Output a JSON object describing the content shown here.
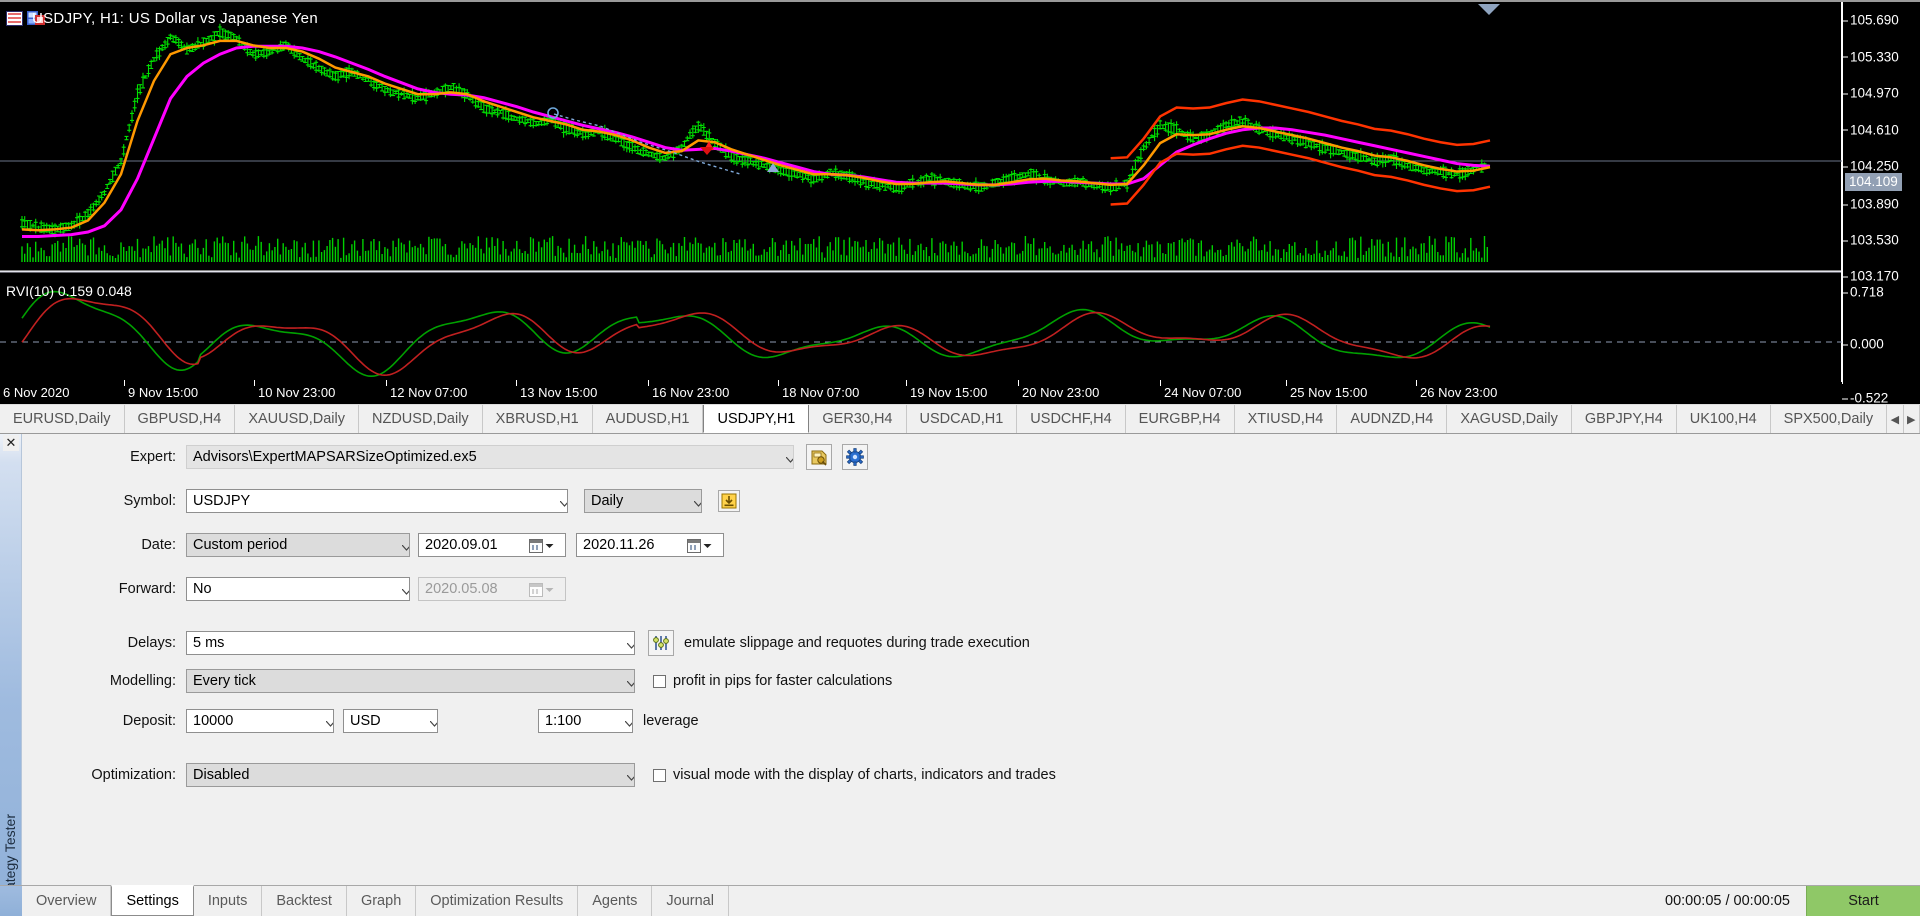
{
  "chart": {
    "title": "USDJPY, H1:  US Dollar vs Japanese Yen",
    "icon_main": "chart-window-icon",
    "icon_save": "save-profile-icon",
    "indicator_label": "RVI(10) 0.159 0.048",
    "price_ticks": [
      "105.690",
      "105.330",
      "104.970",
      "104.610",
      "104.250",
      "103.890",
      "103.530",
      "103.170"
    ],
    "last_price": "104.109",
    "rvi_ticks": [
      "0.718",
      "0.000",
      "-0.522"
    ],
    "time_ticks": [
      "6 Nov 2020",
      "9 Nov 15:00",
      "10 Nov 23:00",
      "12 Nov 07:00",
      "13 Nov 15:00",
      "16 Nov 23:00",
      "18 Nov 07:00",
      "19 Nov 15:00",
      "20 Nov 23:00",
      "24 Nov 07:00",
      "25 Nov 15:00",
      "26 Nov 23:00"
    ],
    "colors": {
      "background": "#000000",
      "bull_candle": "#00ff00",
      "ma_fast": "#ff9900",
      "ma_slow": "#ff00ff",
      "ma_extra": "#ff3300",
      "rvi_main": "#00aa00",
      "rvi_signal": "#cc0000",
      "last_price_bg": "#92a0b4"
    }
  },
  "chart_data": {
    "type": "line",
    "title": "USDJPY, H1: US Dollar vs Japanese Yen",
    "xlabel": "",
    "ylabel": "",
    "ylim": [
      102.99,
      105.87
    ],
    "y_ticks": [
      105.69,
      105.33,
      104.97,
      104.61,
      104.25,
      103.89,
      103.53,
      103.17
    ],
    "x_ticks": [
      "6 Nov 2020",
      "9 Nov 15:00",
      "10 Nov 23:00",
      "12 Nov 07:00",
      "13 Nov 15:00",
      "16 Nov 23:00",
      "18 Nov 07:00",
      "19 Nov 15:00",
      "20 Nov 23:00",
      "24 Nov 07:00",
      "25 Nov 15:00",
      "26 Nov 23:00"
    ],
    "grid": false,
    "last_price": 104.109,
    "series": [
      {
        "name": "Close price (H1 candles)",
        "values": [
          103.45,
          103.4,
          103.38,
          103.42,
          103.55,
          103.8,
          104.15,
          104.9,
          105.3,
          105.55,
          105.4,
          105.48,
          105.6,
          105.52,
          105.35,
          105.38,
          105.45,
          105.3,
          105.2,
          105.1,
          105.15,
          105.05,
          104.95,
          104.9,
          104.85,
          104.92,
          104.98,
          104.88,
          104.75,
          104.7,
          104.62,
          104.58,
          104.6,
          104.52,
          104.45,
          104.48,
          104.4,
          104.3,
          104.22,
          104.18,
          104.3,
          104.55,
          104.35,
          104.2,
          104.15,
          104.1,
          104.05,
          104.0,
          103.95,
          104.02,
          103.98,
          103.92,
          103.88,
          103.85,
          103.9,
          103.95,
          103.92,
          103.88,
          103.85,
          103.9,
          103.95,
          104.0,
          103.95,
          103.9,
          103.92,
          103.88,
          103.85,
          103.9,
          104.3,
          104.55,
          104.5,
          104.4,
          104.45,
          104.55,
          104.6,
          104.5,
          104.45,
          104.4,
          104.35,
          104.3,
          104.25,
          104.2,
          104.15,
          104.18,
          104.1,
          104.05,
          104.02,
          104.0,
          104.05,
          104.109
        ]
      },
      {
        "name": "Moving Average (orange)",
        "values": [
          103.38,
          103.37,
          103.38,
          103.4,
          103.48,
          103.68,
          104.0,
          104.6,
          105.05,
          105.35,
          105.42,
          105.45,
          105.5,
          105.5,
          105.45,
          105.42,
          105.42,
          105.38,
          105.3,
          105.2,
          105.15,
          105.1,
          105.02,
          104.96,
          104.9,
          104.9,
          104.92,
          104.9,
          104.82,
          104.76,
          104.7,
          104.64,
          104.6,
          104.56,
          104.5,
          104.48,
          104.44,
          104.38,
          104.3,
          104.24,
          104.26,
          104.38,
          104.36,
          104.28,
          104.22,
          104.16,
          104.1,
          104.05,
          104.0,
          104.0,
          103.99,
          103.96,
          103.92,
          103.89,
          103.89,
          103.91,
          103.92,
          103.9,
          103.88,
          103.88,
          103.91,
          103.94,
          103.95,
          103.93,
          103.92,
          103.9,
          103.88,
          103.89,
          104.1,
          104.35,
          104.45,
          104.44,
          104.45,
          104.5,
          104.54,
          104.52,
          104.48,
          104.44,
          104.4,
          104.35,
          104.3,
          104.26,
          104.21,
          104.19,
          104.15,
          104.1,
          104.06,
          104.03,
          104.04,
          104.08
        ]
      },
      {
        "name": "Moving Average (magenta)",
        "values": [
          103.3,
          103.3,
          103.31,
          103.32,
          103.35,
          103.42,
          103.6,
          103.95,
          104.4,
          104.85,
          105.1,
          105.25,
          105.35,
          105.42,
          105.44,
          105.44,
          105.44,
          105.42,
          105.38,
          105.32,
          105.25,
          105.18,
          105.1,
          105.03,
          104.96,
          104.92,
          104.9,
          104.89,
          104.86,
          104.81,
          104.76,
          104.7,
          104.65,
          104.6,
          104.55,
          104.51,
          104.47,
          104.42,
          104.36,
          104.3,
          104.27,
          104.28,
          104.29,
          104.26,
          104.22,
          104.18,
          104.13,
          104.08,
          104.03,
          104.0,
          103.99,
          103.97,
          103.94,
          103.91,
          103.9,
          103.9,
          103.9,
          103.89,
          103.88,
          103.88,
          103.89,
          103.91,
          103.92,
          103.92,
          103.91,
          103.9,
          103.89,
          103.89,
          103.95,
          104.1,
          104.25,
          104.33,
          104.4,
          104.46,
          104.5,
          104.52,
          104.52,
          104.5,
          104.47,
          104.44,
          104.4,
          104.36,
          104.32,
          104.28,
          104.24,
          104.2,
          104.16,
          104.12,
          104.1,
          104.09
        ]
      }
    ],
    "subplot": {
      "type": "line",
      "title": "RVI(10) 0.159 0.048",
      "ylim": [
        -0.62,
        0.82
      ],
      "y_ticks": [
        0.718,
        0.0,
        -0.522
      ],
      "series": [
        {
          "name": "RVI main",
          "value_now": 0.159
        },
        {
          "name": "RVI signal",
          "value_now": 0.048
        }
      ]
    }
  },
  "symbol_tabs": {
    "items": [
      "EURUSD,Daily",
      "GBPUSD,H4",
      "XAUUSD,Daily",
      "NZDUSD,Daily",
      "XBRUSD,H1",
      "AUDUSD,H1",
      "USDJPY,H1",
      "GER30,H4",
      "USDCAD,H1",
      "USDCHF,H4",
      "EURGBP,H4",
      "XTIUSD,H4",
      "AUDNZD,H4",
      "XAGUSD,Daily",
      "GBPJPY,H4",
      "UK100,H4",
      "SPX500,Daily"
    ],
    "active": "USDJPY,H1",
    "nav_prev": "◀",
    "nav_next": "▶"
  },
  "tester": {
    "panel_title": "Strategy Tester",
    "close_label": "✕",
    "fields": {
      "expert_label": "Expert:",
      "expert_value": "Advisors\\ExpertMAPSARSizeOptimized.ex5",
      "expert_browse_icon": "expert-browse-icon",
      "expert_settings_icon": "gear-icon",
      "symbol_label": "Symbol:",
      "symbol_value": "USDJPY",
      "timeframe_value": "Daily",
      "chart_icon": "download-symbol-icon",
      "date_label": "Date:",
      "date_mode": "Custom period",
      "date_from": "2020.09.01",
      "date_to": "2020.11.26",
      "forward_label": "Forward:",
      "forward_mode": "No",
      "forward_date": "2020.05.08",
      "delays_label": "Delays:",
      "delays_value": "5 ms",
      "delays_icon": "sliders-icon",
      "delays_hint": "emulate slippage and requotes during trade execution",
      "modelling_label": "Modelling:",
      "modelling_value": "Every tick",
      "pips_checkbox_label": "profit in pips for faster calculations",
      "pips_checked": false,
      "deposit_label": "Deposit:",
      "deposit_value": "10000",
      "currency_value": "USD",
      "leverage_value": "1:100",
      "leverage_suffix": "leverage",
      "optimization_label": "Optimization:",
      "optimization_value": "Disabled",
      "visual_checkbox_label": "visual mode with the display of charts, indicators and trades",
      "visual_checked": false
    }
  },
  "bottom": {
    "tabs": [
      "Overview",
      "Settings",
      "Inputs",
      "Backtest",
      "Graph",
      "Optimization Results",
      "Agents",
      "Journal"
    ],
    "active": "Settings",
    "timer": "00:00:05 / 00:00:05",
    "start_label": "Start",
    "start_color": "#8fc867"
  }
}
